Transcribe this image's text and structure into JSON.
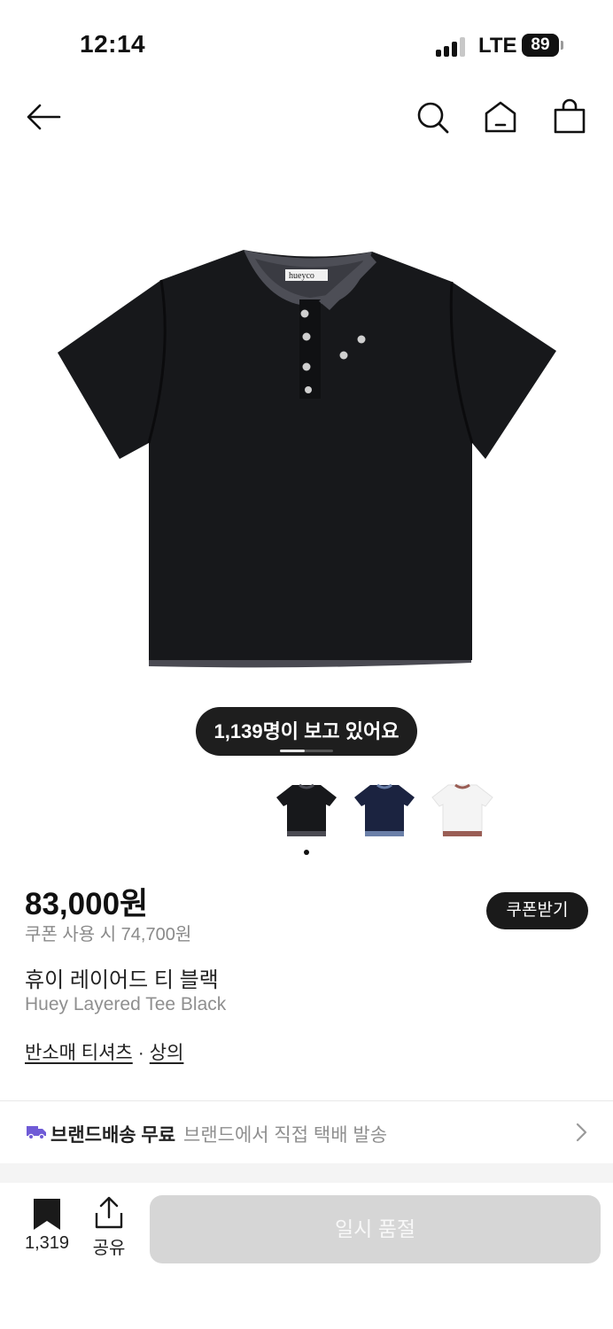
{
  "status_bar": {
    "time": "12:14",
    "network": "LTE",
    "battery": "89"
  },
  "nav": {
    "back_icon": "arrow-left-icon",
    "search_icon": "search-icon",
    "home_icon": "home-icon",
    "cart_icon": "shopping-bag-icon"
  },
  "gallery": {
    "viewers_text": "1,139명이 보고 있어요",
    "thumbnails": [
      "black",
      "navy",
      "white"
    ],
    "selected_index": 0
  },
  "product": {
    "price": "83,000원",
    "coupon_price": "쿠폰 사용 시 74,700원",
    "coupon_button": "쿠폰받기",
    "name_ko": "휴이 레이어드 티 블랙",
    "name_en": "Huey Layered Tee Black",
    "category_1": "반소매 티셔츠",
    "category_sep": "·",
    "category_2": "상의"
  },
  "shipping": {
    "label_strong": "브랜드배송 무료",
    "label_desc": "브랜드에서 직접 택배 발송"
  },
  "bottom_bar": {
    "bookmark_count": "1,319",
    "share_label": "공유",
    "soldout_label": "일시 품절"
  },
  "colors": {
    "accent_truck": "#6f5bd6",
    "soldout_bg": "#d6d6d6",
    "pill_bg": "#1e1e1e"
  }
}
